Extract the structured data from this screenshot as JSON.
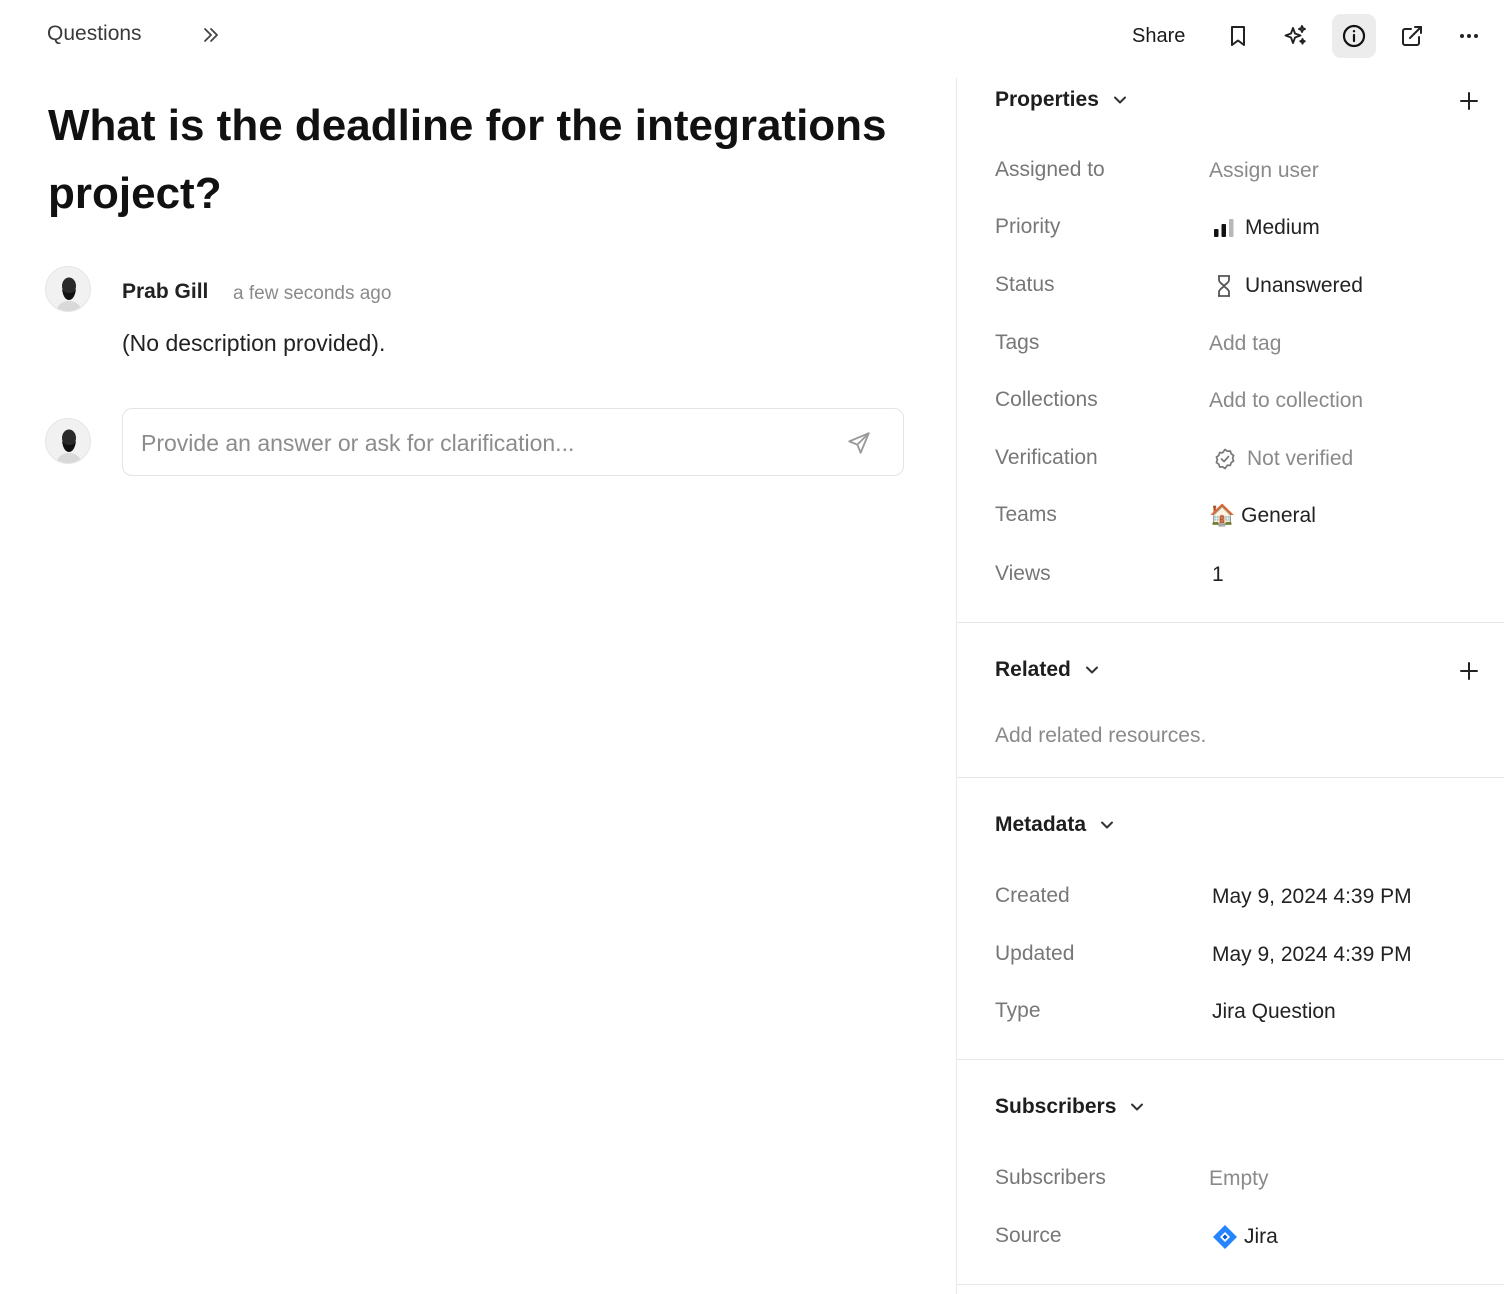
{
  "topbar": {
    "breadcrumb": "Questions",
    "share_label": "Share",
    "icons": [
      "expand-icon",
      "bookmark-icon",
      "sparkle-icon",
      "info-icon",
      "open-external-icon",
      "more-icon"
    ]
  },
  "question": {
    "title": "What is the deadline for the integrations project?",
    "author": "Prab Gill",
    "time": "a few seconds ago",
    "description": "(No description provided)."
  },
  "reply": {
    "placeholder": "Provide an answer or ask for clarification..."
  },
  "properties": {
    "heading": "Properties",
    "assigned_label": "Assigned to",
    "assigned_value": "Assign user",
    "priority_label": "Priority",
    "priority_value": "Medium",
    "status_label": "Status",
    "status_value": "Unanswered",
    "tags_label": "Tags",
    "tags_value": "Add tag",
    "collections_label": "Collections",
    "collections_value": "Add to collection",
    "verification_label": "Verification",
    "verification_value": "Not verified",
    "teams_label": "Teams",
    "teams_emoji": "🏠",
    "teams_value": "General",
    "views_label": "Views",
    "views_value": "1"
  },
  "related": {
    "heading": "Related",
    "hint": "Add related resources."
  },
  "metadata": {
    "heading": "Metadata",
    "created_label": "Created",
    "created_value": "May 9, 2024 4:39 PM",
    "updated_label": "Updated",
    "updated_value": "May 9, 2024 4:39 PM",
    "type_label": "Type",
    "type_value": "Jira Question"
  },
  "subscribers": {
    "heading": "Subscribers",
    "subscribers_label": "Subscribers",
    "subscribers_value": "Empty",
    "source_label": "Source",
    "source_value": "Jira"
  },
  "colors": {
    "jira_blue": "#2684FF",
    "active_button_bg": "#ececec"
  }
}
